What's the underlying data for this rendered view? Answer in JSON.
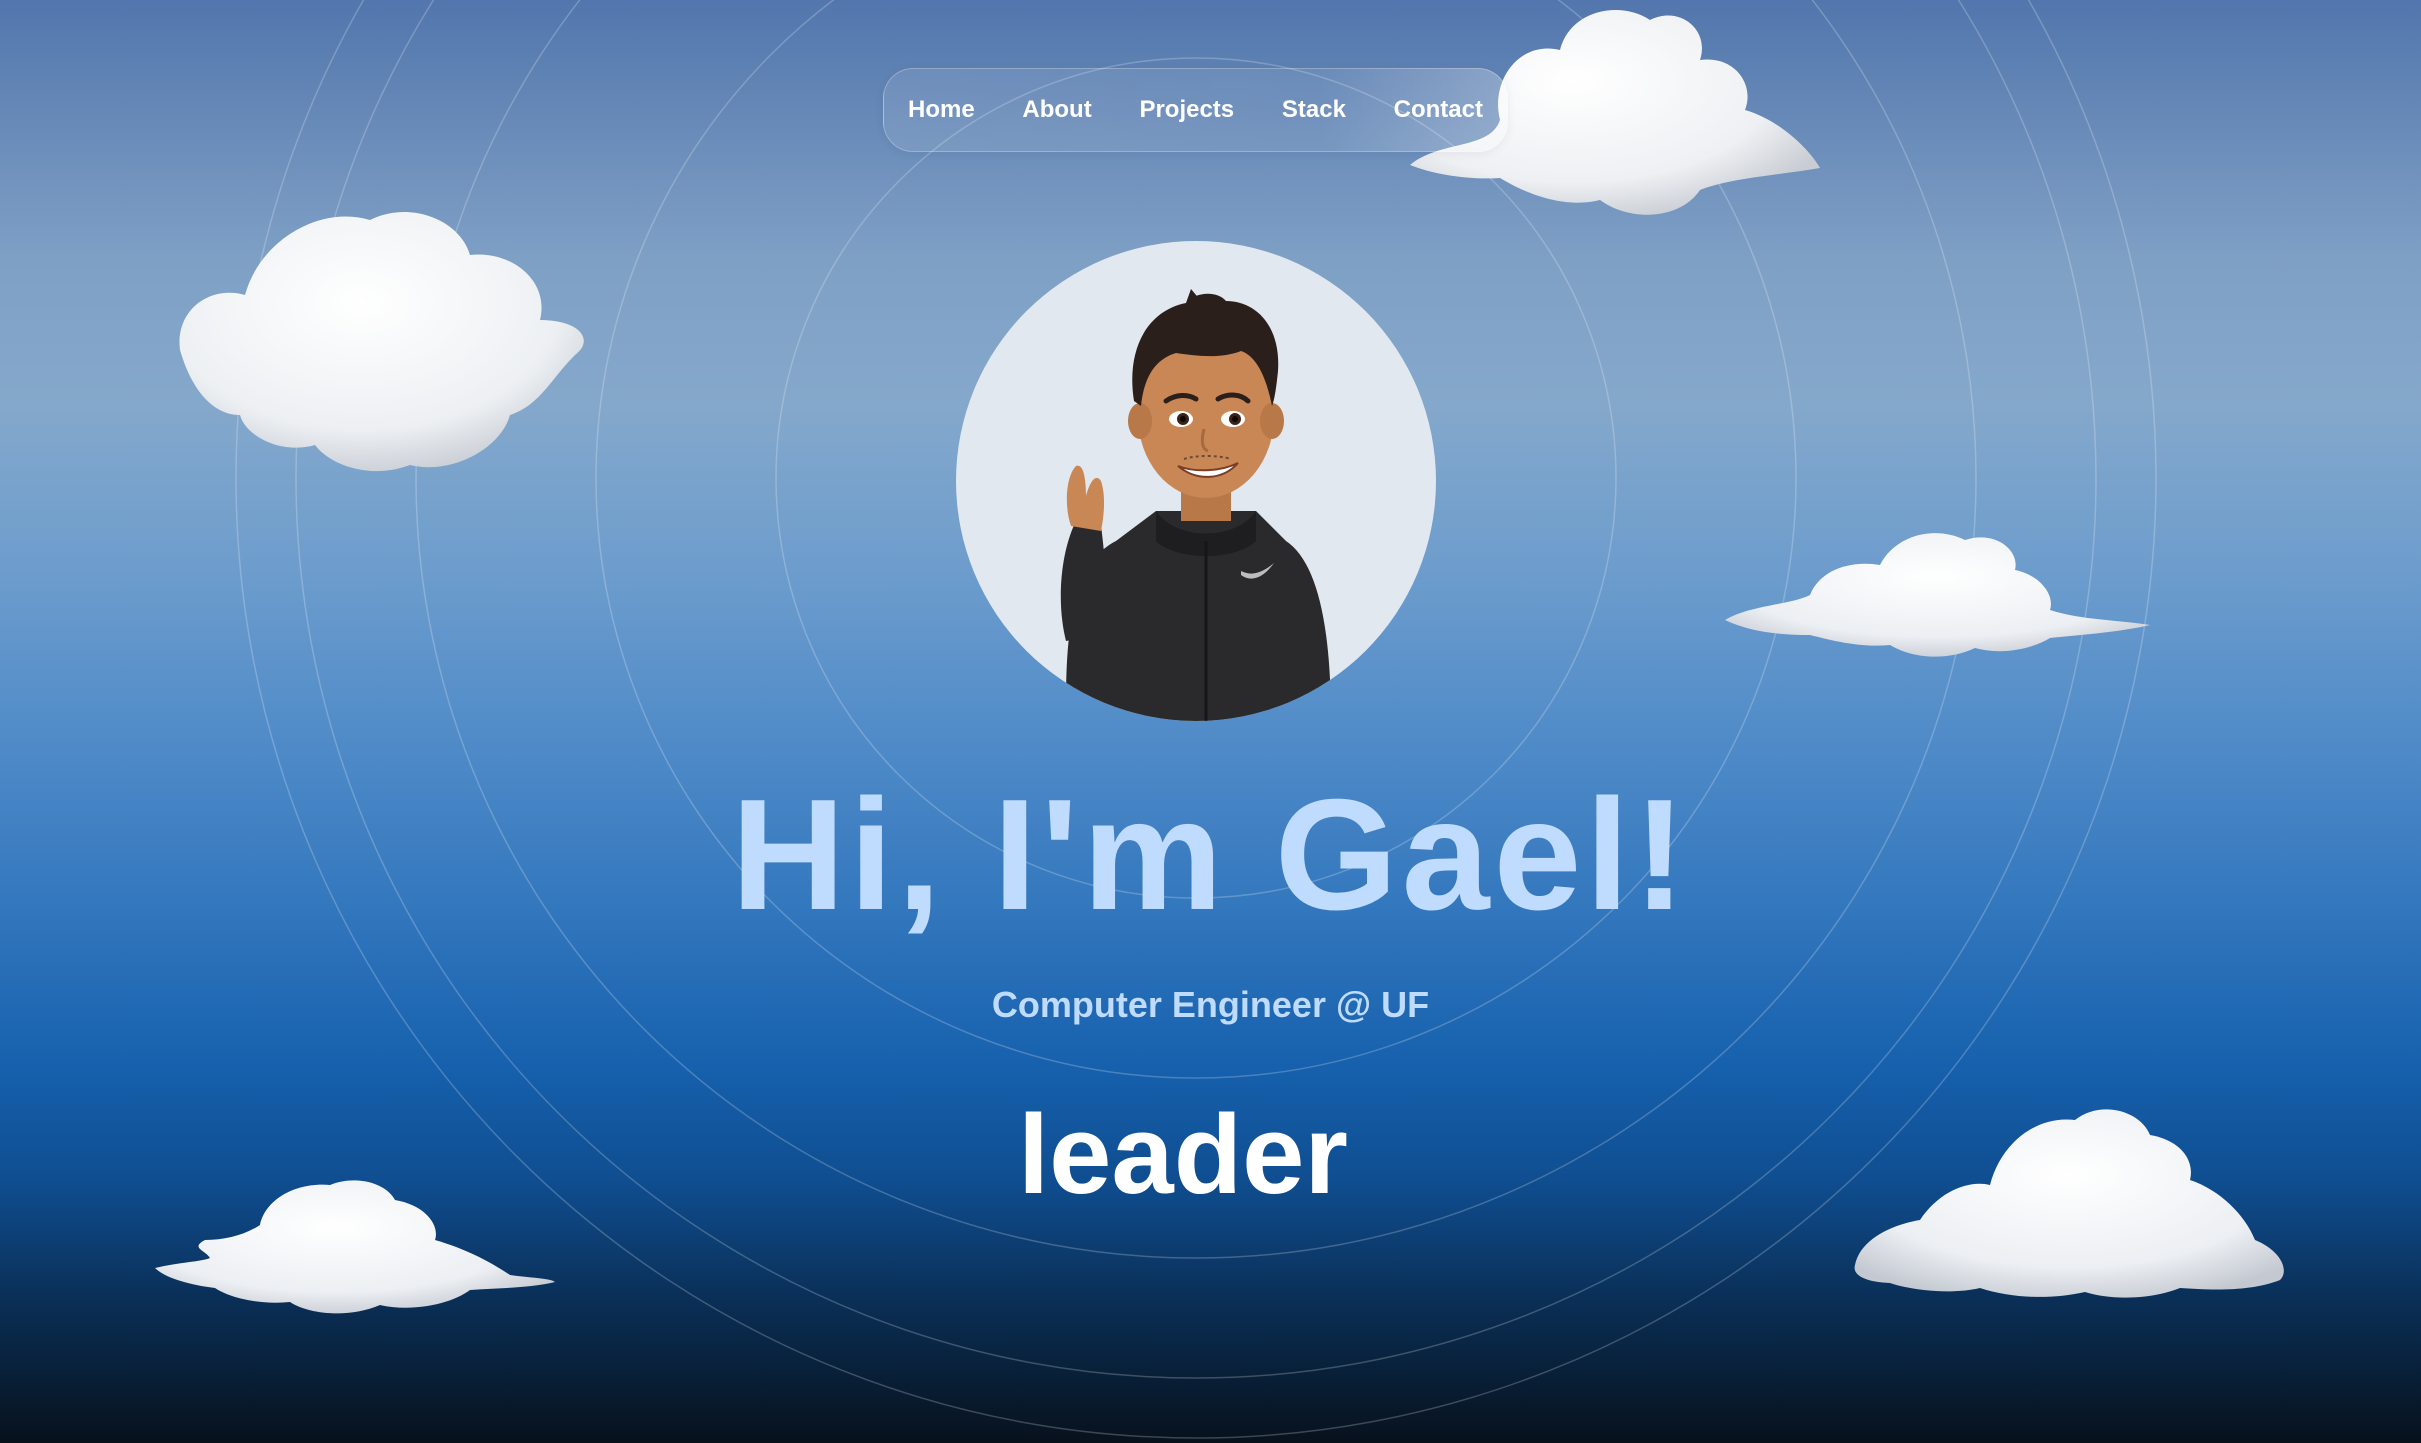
{
  "nav": {
    "items": [
      {
        "label": "Home"
      },
      {
        "label": "About"
      },
      {
        "label": "Projects"
      },
      {
        "label": "Stack"
      },
      {
        "label": "Contact"
      }
    ]
  },
  "hero": {
    "title": "Hi, I'm Gael!",
    "subtitle": "Computer Engineer @ UF",
    "role": "leader"
  },
  "colors": {
    "title": "#bfdbfe",
    "subtitle": "#bfdbfe",
    "role": "#ffffff",
    "avatar_bg": "#e2e8f0"
  }
}
